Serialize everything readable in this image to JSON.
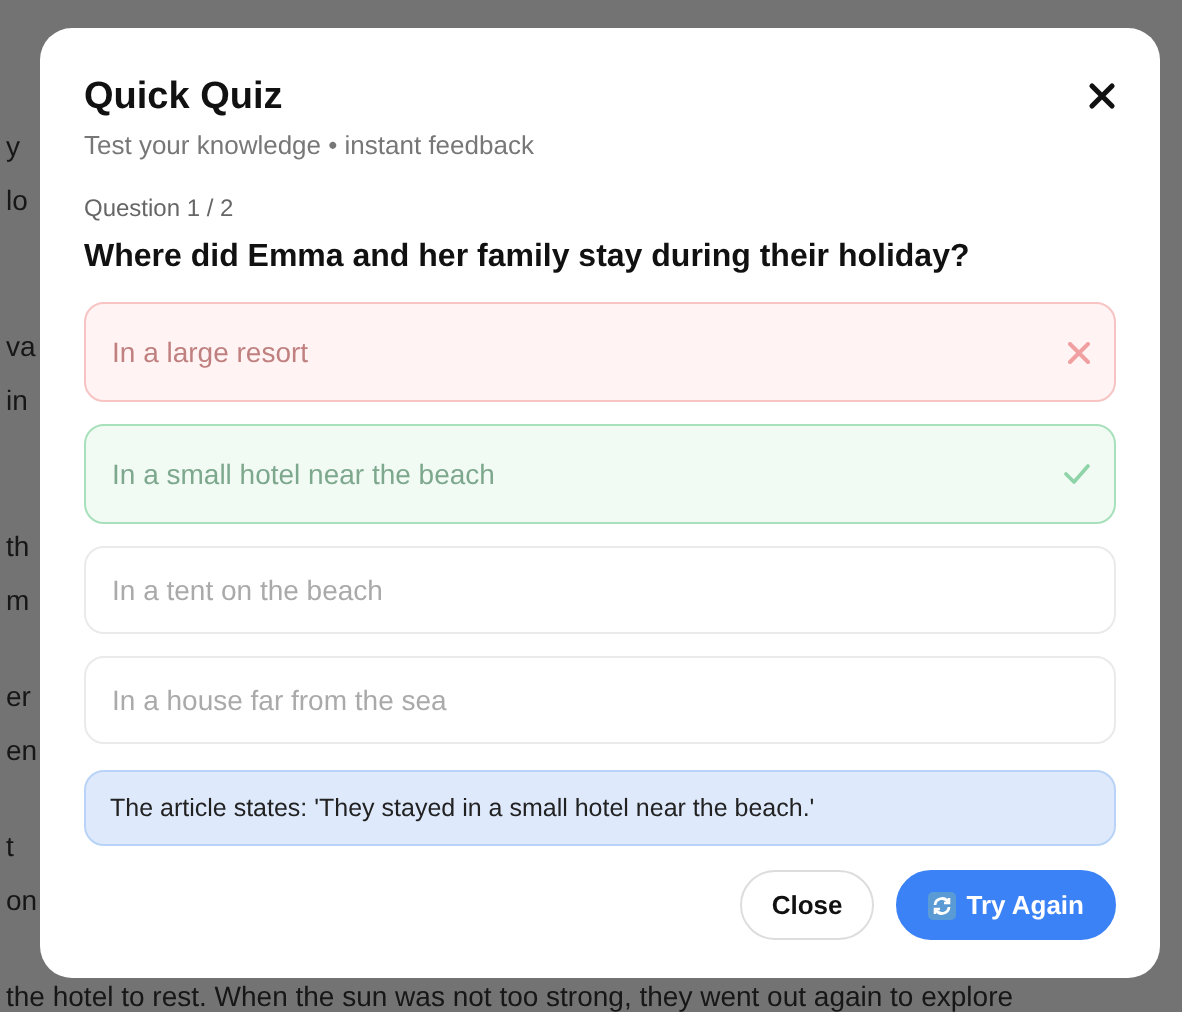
{
  "background_article": {
    "paragraphs": [
      [
        "y",
        "lo"
      ],
      [
        "va",
        "in"
      ],
      [
        "th",
        "m"
      ],
      [
        "er",
        "en"
      ],
      [
        "t",
        "on"
      ],
      [
        "the hotel to rest. When the sun was not too strong, they went out again to explore"
      ]
    ]
  },
  "modal": {
    "title": "Quick Quiz",
    "subtitle": "Test your knowledge • instant feedback",
    "progress": "Question 1 / 2",
    "question": "Where did Emma and her family stay during their holiday?",
    "options": [
      {
        "label": "In a large resort",
        "selected": true,
        "correct": false
      },
      {
        "label": "In a small hotel near the beach",
        "selected": false,
        "correct": true
      },
      {
        "label": "In a tent on the beach",
        "selected": false,
        "correct": false
      },
      {
        "label": "In a house far from the sea",
        "selected": false,
        "correct": false
      }
    ],
    "feedback": "The article states: 'They stayed in a small hotel near the beach.'",
    "buttons": [
      {
        "label": "Close",
        "kind": "secondary"
      },
      {
        "label": "Try Again",
        "kind": "primary"
      }
    ]
  }
}
